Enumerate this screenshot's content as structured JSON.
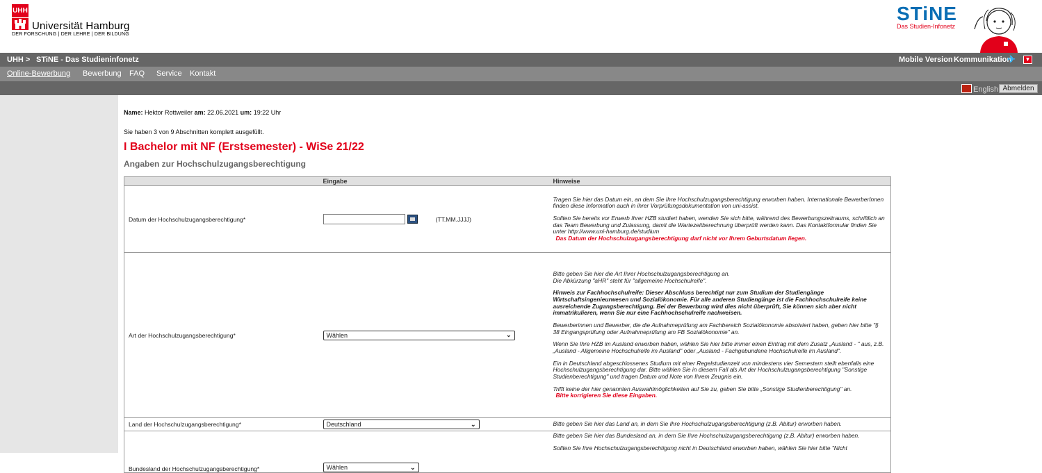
{
  "header": {
    "uni_logo_text": "UHH",
    "uni_name": "Universität Hamburg",
    "uni_motto": "DER FORSCHUNG | DER LEHRE | DER BILDUNG",
    "stine_logo_a": "STi",
    "stine_logo_b": "NE",
    "stine_sub": "Das Studien-Infonetz"
  },
  "topbar": {
    "breadcrumb_uhh": "UHH >",
    "breadcrumb_stine": "STiNE - Das Studieninfonetz",
    "mobile": "Mobile Version",
    "kommunikation": "Kommunikation"
  },
  "nav": {
    "items": [
      "Online-Bewerbung",
      "Bewerbung",
      "FAQ",
      "Service",
      "Kontakt"
    ]
  },
  "utility": {
    "lang": "English",
    "logout": "Abmelden"
  },
  "session": {
    "name_label": "Name:",
    "name": "Hektor Rottweiler",
    "date_label": "am:",
    "date": "22.06.2021",
    "time_label": "um:",
    "time": "19:22 Uhr",
    "progress": "Sie haben 3 von 9 Abschnitten komplett ausgefüllt."
  },
  "page": {
    "title": "I Bachelor mit NF (Erstsemester) - WiSe 21/22",
    "section": "Angaben zur Hochschulzugangsberechtigung"
  },
  "table": {
    "headers": [
      "",
      "Eingabe",
      "Hinweise"
    ],
    "date_row": {
      "label": "Datum der Hochschulzugangsberechtigung*",
      "value": "",
      "format": "(TT.MM.JJJJ)",
      "hint1": "Tragen Sie hier das Datum ein, an dem Sie Ihre Hochschulzugangsberechtigung erworben haben. Internationale BewerberInnen finden diese Information auch in ihrer Vorprüfungsdokumentation von uni-assist.",
      "hint2": "Sollten Sie bereits vor Erwerb Ihrer HZB studiert haben, wenden Sie sich bitte, während des Bewerbungszeitraums, schriftlich an das Team Bewerbung und Zulassung, damit die Wartezeitberechnung überprüft werden kann. Das Kontaktformular finden Sie unter http://www.uni-hamburg.de/studium",
      "error": "Das Datum der Hochschulzugangsberechtigung darf nicht vor Ihrem Geburtsdatum liegen."
    },
    "art_row": {
      "label": "Art der Hochschulzugangsberechtigung*",
      "value": "Wählen",
      "hint1": "Bitte geben Sie hier die Art Ihrer Hochschulzugangsberechtigung an.",
      "hint1b": "Die Abkürzung \"aHR\" steht für \"allgemeine Hochschulreife\".",
      "hint2": "Hinweis zur Fachhochschulreife: Dieser Abschluss berechtigt nur zum Studium der Studiengänge Wirtschaftsingenieurwesen und Sozialökonomie. Für alle anderen Studiengänge ist die Fachhochschulreife keine ausreichende Zugangsberechtigung. Bei der Bewerbung wird dies nicht überprüft, Sie können sich aber nicht immatrikulieren, wenn Sie nur eine Fachhochschulreife nachweisen.",
      "hint3": "Bewerberinnen und Bewerber, die die Aufnahmeprüfung am Fachbereich Sozialökonomie absolviert haben, geben hier bitte \"§ 38 Eingangsprüfung oder Aufnahmeprüfung am FB Sozialökonomie\" an.",
      "hint4": "Wenn Sie Ihre HZB im Ausland erworben haben, wählen Sie hier bitte immer einen Eintrag mit dem Zusatz „Ausland - \" aus, z.B. „Ausland - Allgemeine Hochschulreife im Ausland\" oder „Ausland - Fachgebundene Hochschulreife im Ausland\".",
      "hint5": "Ein in Deutschland abgeschlossenes Studium mit einer Regelstudienzeit von mindestens vier Semestern stellt ebenfalls eine Hochschulzugangsberechtigung dar. Bitte wählen Sie in diesem Fall als Art der Hochschulzugangsberechtigung \"Sonstige Studienberechtigung\" und tragen Datum und Note von Ihrem Zeugnis ein.",
      "hint6": "Trifft keine der hier genannten Auswahlmöglichkeiten auf Sie zu, geben Sie bitte „Sonstige Studienberechtigung\" an.",
      "error": "Bitte korrigieren Sie diese Eingaben."
    },
    "land_row": {
      "label": "Land der Hochschulzugangsberechtigung*",
      "value": "Deutschland",
      "hint": "Bitte geben Sie hier das Land an, in dem Sie Ihre Hochschulzugangsberechtigung (z.B. Abitur) erworben haben."
    },
    "bundesland_row": {
      "label": "Bundesland der Hochschulzugangsberechtigung*",
      "value": "Wählen",
      "hint1": "Bitte geben Sie hier das Bundesland an, in dem Sie Ihre Hochschulzugangsberechtigung (z.B. Abitur) erworben haben.",
      "hint2": "Sollten Sie Ihre Hochschulzugangsberechtigung nicht in Deutschland erworben haben, wählen Sie hier bitte \"Nicht"
    }
  }
}
